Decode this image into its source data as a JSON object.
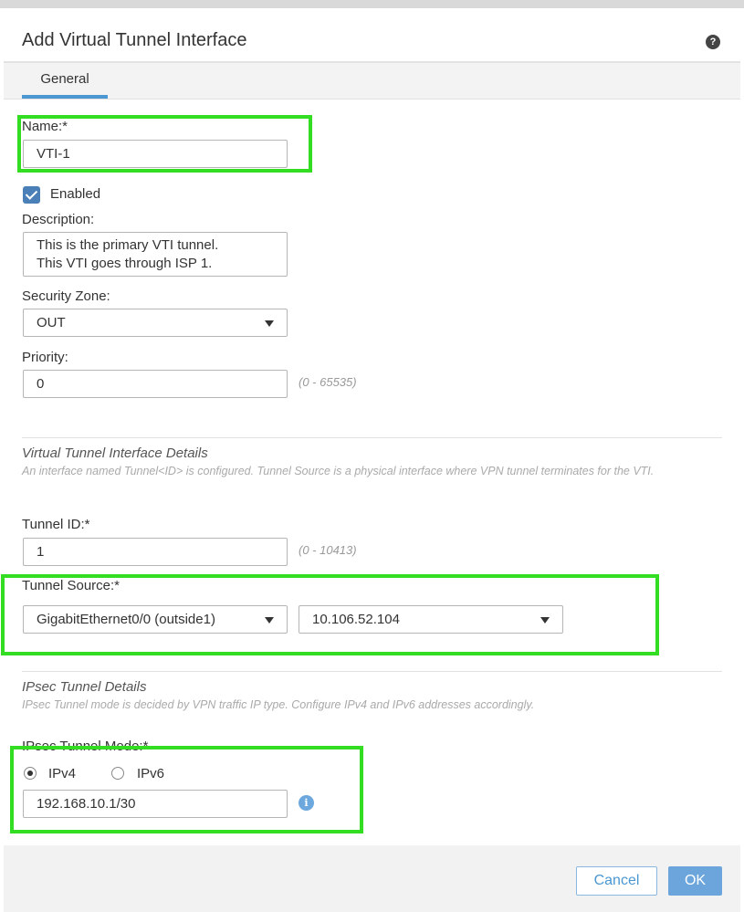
{
  "dialog": {
    "title": "Add Virtual Tunnel Interface",
    "help_icon": "?"
  },
  "tabs": [
    {
      "label": "General",
      "active": true
    }
  ],
  "name": {
    "label": "Name:*",
    "value": "VTI-1"
  },
  "enabled": {
    "label": "Enabled",
    "checked": true
  },
  "description": {
    "label": "Description:",
    "lines": [
      "This is the primary VTI tunnel.",
      "This VTI goes through ISP 1."
    ]
  },
  "security_zone": {
    "label": "Security Zone:",
    "value": "OUT"
  },
  "priority": {
    "label": "Priority:",
    "value": "0",
    "range": "(0 - 65535)"
  },
  "vti_details": {
    "title": "Virtual Tunnel Interface Details",
    "description": "An interface named Tunnel<ID> is configured. Tunnel Source is a physical interface where VPN tunnel terminates for the VTI."
  },
  "tunnel_id": {
    "label": "Tunnel ID:*",
    "value": "1",
    "range": "(0 - 10413)"
  },
  "tunnel_source": {
    "label": "Tunnel Source:*",
    "interface": "GigabitEthernet0/0 (outside1)",
    "address": "10.106.52.104"
  },
  "ipsec_details": {
    "title": "IPsec Tunnel Details",
    "description": "IPsec Tunnel mode is decided by VPN traffic IP type. Configure IPv4 and IPv6 addresses accordingly."
  },
  "ipsec_mode": {
    "label": "IPsec Tunnel Mode:*",
    "options": [
      {
        "label": "IPv4",
        "selected": true
      },
      {
        "label": "IPv6",
        "selected": false
      }
    ],
    "address": "192.168.10.1/30",
    "info_icon": "i"
  },
  "footer": {
    "cancel_label": "Cancel",
    "ok_label": "OK"
  },
  "colors": {
    "highlight": "#33dd22",
    "accent": "#4b97d1",
    "ok_button": "#6ba5dc"
  }
}
